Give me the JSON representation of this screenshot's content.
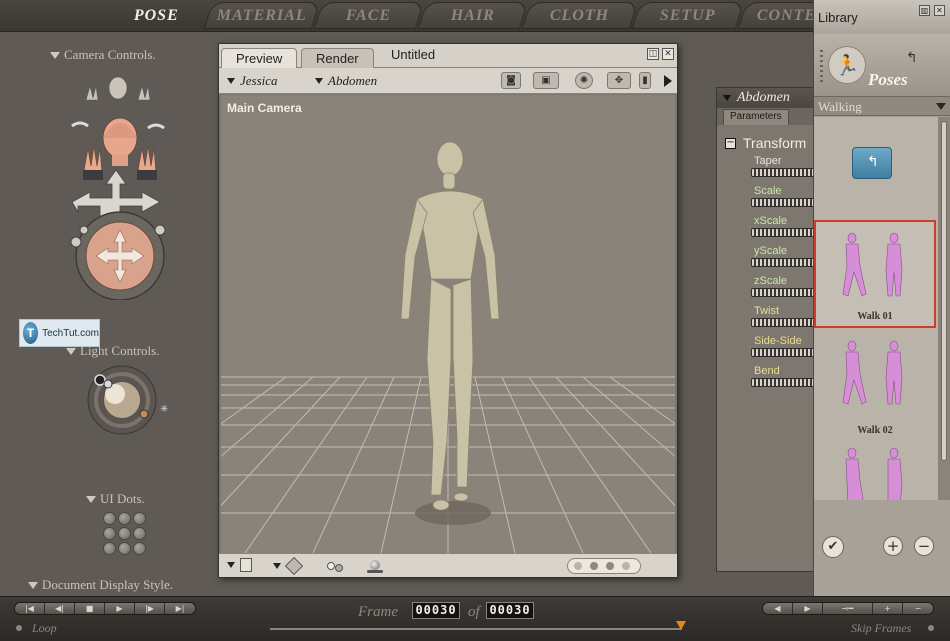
{
  "tabs": [
    {
      "label": "POSE",
      "active": true
    },
    {
      "label": "MATERIAL",
      "active": false
    },
    {
      "label": "FACE",
      "active": false
    },
    {
      "label": "HAIR",
      "active": false
    },
    {
      "label": "CLOTH",
      "active": false
    },
    {
      "label": "SETUP",
      "active": false
    },
    {
      "label": "CONTE",
      "active": false
    }
  ],
  "left_panel": {
    "camera_controls_label": "Camera Controls.",
    "light_controls_label": "Light Controls.",
    "ui_dots_label": "UI Dots.",
    "doc_display_label": "Document Display Style."
  },
  "watermark": {
    "text": "TechTut.com",
    "icon_letter": "T"
  },
  "preview": {
    "tab_preview": "Preview",
    "tab_render": "Render",
    "doc_title": "Untitled",
    "figure_select": "Jessica",
    "part_select": "Abdomen",
    "camera_label": "Main Camera"
  },
  "params": {
    "header": "Abdomen",
    "tab": "Parameters",
    "group": "Transform",
    "group_toggle": "−",
    "items": [
      {
        "name": "Taper",
        "color": "#e8e3da"
      },
      {
        "name": "Scale",
        "color": "#cde6a4"
      },
      {
        "name": "xScale",
        "color": "#cde6a4"
      },
      {
        "name": "yScale",
        "color": "#cde6a4"
      },
      {
        "name": "zScale",
        "color": "#cde6a4"
      },
      {
        "name": "Twist",
        "color": "#e9de8e"
      },
      {
        "name": "Side-Side",
        "color": "#e9de8e"
      },
      {
        "name": "Bend",
        "color": "#e9de8e"
      }
    ]
  },
  "library": {
    "title": "Library",
    "category": "Poses",
    "subcategory": "Walking",
    "items": [
      {
        "label": "Walk 01",
        "selected": true
      },
      {
        "label": "Walk 02",
        "selected": false
      },
      {
        "label": "",
        "selected": false
      }
    ]
  },
  "timeline": {
    "frame_label": "Frame",
    "of_label": "of",
    "current_frame": "00030",
    "total_frames": "00030",
    "loop_label": "Loop",
    "skip_frames_label": "Skip Frames"
  },
  "colors": {
    "accent_selected": "#d23a2a",
    "timeline_marker": "#e08a1e",
    "skin": "#c9c2a6"
  }
}
